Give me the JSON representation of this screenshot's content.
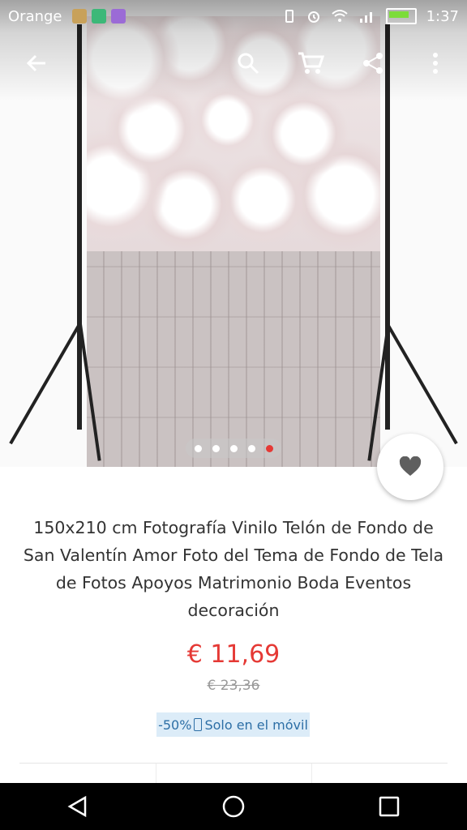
{
  "status_bar": {
    "carrier": "Orange",
    "time": "1:37"
  },
  "toolbar": {
    "back_icon": "arrow-left-icon",
    "search_icon": "search-icon",
    "cart_icon": "cart-icon",
    "share_icon": "share-icon",
    "more_icon": "more-vertical-icon"
  },
  "gallery": {
    "image_count": 5,
    "active_index": 4,
    "accent": "#e53935"
  },
  "product": {
    "title": "150x210 cm Fotografía Vinilo Telón de Fondo de San Valentín Amor Foto del Tema de Fondo de Tela de Fotos Apoyos Matrimonio Boda Eventos decoración",
    "price": "€ 11,69",
    "old_price": "€ 23,36",
    "discount": "-50%",
    "promo_text": "Solo en el móvil"
  },
  "colors": {
    "price": "#e53935",
    "promo_bg": "#dcecf8",
    "promo_text": "#2d6fa6"
  }
}
